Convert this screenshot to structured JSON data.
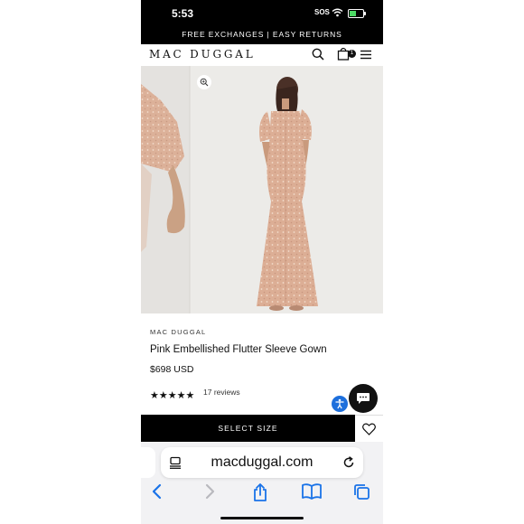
{
  "status_bar": {
    "time": "5:53",
    "sos": "SOS",
    "battery_level": 0.5
  },
  "promo_banner": {
    "text": "FREE EXCHANGES | EASY RETURNS"
  },
  "header": {
    "logo": "MAC DUGGAL",
    "cart_count": "1",
    "icons": [
      "search-icon",
      "bag-icon",
      "menu-icon"
    ]
  },
  "product": {
    "brand": "MAC DUGGAL",
    "title": "Pink Embellished Flutter Sleeve Gown",
    "price": "$698 USD",
    "stars": "★★★★★",
    "rating": 5,
    "reviews": "17 reviews",
    "select_size_label": "SELECT SIZE"
  },
  "browser": {
    "url": "macduggal.com",
    "toolbar_icons": [
      "back-icon",
      "forward-icon",
      "share-icon",
      "bookmarks-icon",
      "tabs-icon"
    ]
  },
  "colors": {
    "accent": "#000000",
    "gown": "#d9a88f",
    "accessibility": "#1d6fdc",
    "background": "#e9e7e4"
  }
}
